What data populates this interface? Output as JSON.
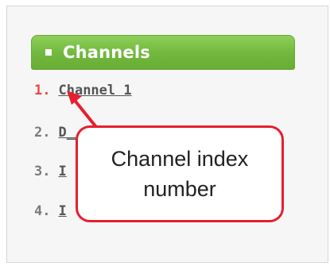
{
  "channels_panel": {
    "title": "Channels",
    "items": [
      {
        "index": "1.",
        "label": "Channel 1",
        "index_color": "#e8483f"
      },
      {
        "index": "2.",
        "label": "D_____ ___ _ _ _",
        "index_color": "#7a7a7a"
      },
      {
        "index": "3.",
        "label": "I",
        "index_color": "#7a7a7a"
      },
      {
        "index": "4.",
        "label": "I",
        "index_color": "#7a7a7a"
      }
    ]
  },
  "callout": {
    "line1": "Channel index",
    "line2": "number",
    "border_color": "#e51f2f"
  },
  "colors": {
    "header_green": "#74b93f",
    "accent_red": "#e51f2f"
  }
}
